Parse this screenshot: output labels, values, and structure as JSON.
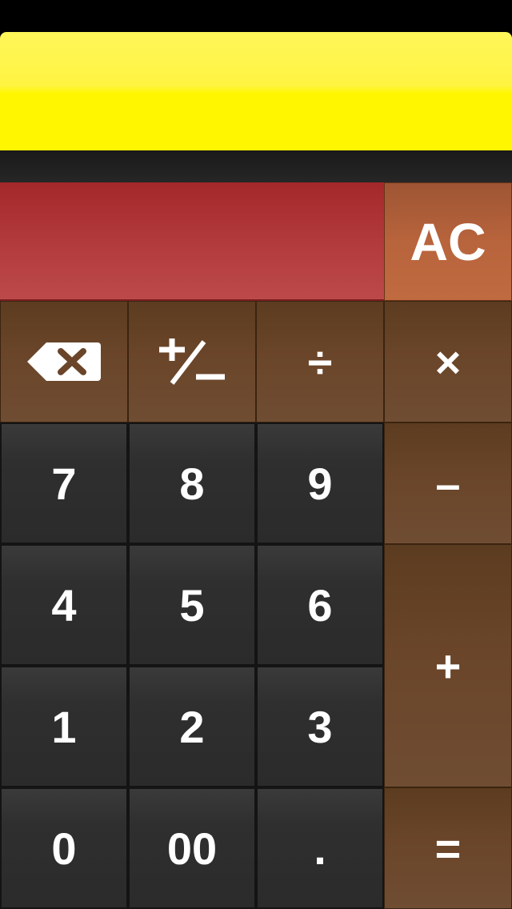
{
  "display": {
    "value": ""
  },
  "keys": {
    "ac": "AC",
    "divide": "÷",
    "multiply": "×",
    "minus": "–",
    "plus": "+",
    "equals": "=",
    "seven": "7",
    "eight": "8",
    "nine": "9",
    "four": "4",
    "five": "5",
    "six": "6",
    "one": "1",
    "two": "2",
    "three": "3",
    "zero": "0",
    "double_zero": "00",
    "decimal": "."
  },
  "icons": {
    "backspace": "backspace-icon",
    "plus_minus": "plus-minus-icon"
  },
  "colors": {
    "banner": "#fff600",
    "display": "#b23a3c",
    "clear_key": "#b8643c",
    "operator_key": "#6a4529",
    "number_key": "#2f2f2f"
  }
}
